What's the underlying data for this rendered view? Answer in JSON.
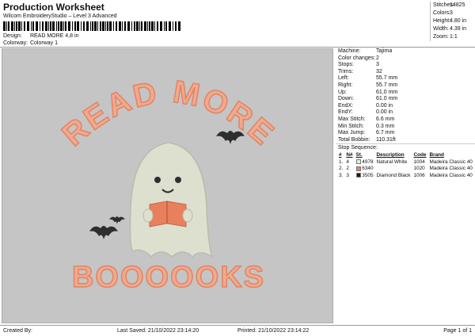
{
  "header": {
    "title": "Production Worksheet",
    "subtitle": "Wilcom EmbroideryStudio – Level 3 Advanced",
    "design_label": "Design:",
    "design_value": "READ MORE 4,8 in",
    "colorway_label": "Colorway:",
    "colorway_value": "Colorway 1"
  },
  "stats": [
    {
      "label": "Stitches:",
      "value": "14825"
    },
    {
      "label": "Colors:",
      "value": "3"
    },
    {
      "label": "Height:",
      "value": "4.80 in"
    },
    {
      "label": "Width:",
      "value": "4.39 in"
    },
    {
      "label": "Zoom:",
      "value": "1:1"
    }
  ],
  "design": {
    "top_text": "READ MORE",
    "bottom_text": "BOOOOOKS",
    "colors": {
      "canvas": "#c5c5c5",
      "peach": "#f2a98c",
      "peach_outline": "#e08466",
      "ghost": "#dde0cf",
      "book": "#e8805e",
      "dark": "#2e2e2e"
    }
  },
  "info": [
    {
      "label": "Machine:",
      "value": "Tajima"
    },
    {
      "label": "Color changes:",
      "value": "2"
    },
    {
      "label": "Stops:",
      "value": "3"
    },
    {
      "label": "Trims:",
      "value": "32"
    },
    {
      "label": "Left:",
      "value": "55.7 mm"
    },
    {
      "label": "Right:",
      "value": "55.7 mm"
    },
    {
      "label": "Up:",
      "value": "61.0 mm"
    },
    {
      "label": "Down:",
      "value": "61.0 mm"
    },
    {
      "label": "EndX:",
      "value": "0.00 in"
    },
    {
      "label": "EndY:",
      "value": "0.00 in"
    },
    {
      "label": "Max Stitch:",
      "value": "6.6 mm"
    },
    {
      "label": "Min Stitch:",
      "value": "0.3 mm"
    },
    {
      "label": "Max Jump:",
      "value": "6.7 mm"
    },
    {
      "label": "Total Bobbin:",
      "value": "110.31ft"
    }
  ],
  "sequence": {
    "title": "Stop Sequence:",
    "headers": [
      "#",
      "N#",
      "St.",
      "Description",
      "Code",
      "Brand"
    ],
    "rows": [
      {
        "num": "1.",
        "n": "4",
        "color": "#e9ebe4",
        "st": "4978",
        "desc": "Natural White",
        "code": "1004",
        "brand": "Madeira Classic 40"
      },
      {
        "num": "2.",
        "n": "2",
        "color": "#f07f6b",
        "st": "6340",
        "desc": "",
        "code": "1020",
        "brand": "Madeira Classic 40"
      },
      {
        "num": "3.",
        "n": "3",
        "color": "#1a1a1a",
        "st": "3505",
        "desc": "Diamond Black",
        "code": "1006",
        "brand": "Madeira Classic 40"
      }
    ]
  },
  "footer": {
    "created_by": "Created By:",
    "last_saved": "Last Saved: 21/10/2022 23:14:20",
    "printed": "Printed: 21/10/2022 23:14:22",
    "page": "Page 1 of 1"
  }
}
